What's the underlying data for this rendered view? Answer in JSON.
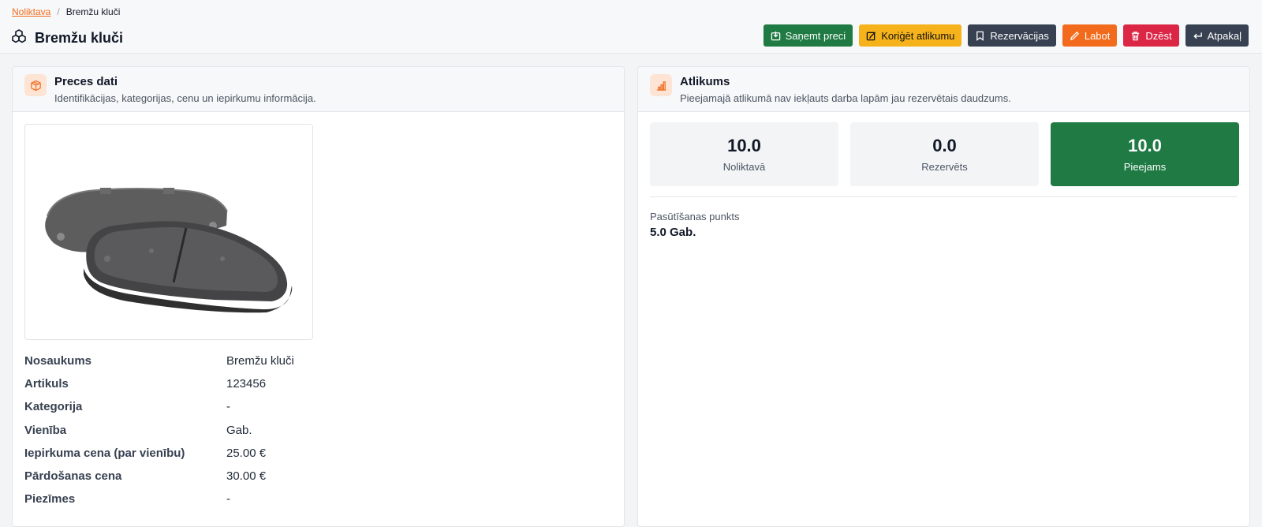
{
  "breadcrumb": {
    "parent": "Noliktava",
    "current": "Bremžu kluči"
  },
  "page": {
    "title": "Bremžu kluči",
    "title_icon": "cubes-icon"
  },
  "actions": {
    "receive": "Saņemt preci",
    "adjust": "Koriģēt atlikumu",
    "reservations": "Rezervācijas",
    "edit": "Labot",
    "delete": "Dzēst",
    "back": "Atpakaļ"
  },
  "colors": {
    "accent": "#f26b1d",
    "green": "#1f7a43",
    "yellow": "#f5b21a",
    "dark": "#374151",
    "red": "#dc2646"
  },
  "product_card": {
    "title": "Preces dati",
    "subtitle": "Identifikācijas, kategorijas, cenu un iepirkumu informācija.",
    "icon": "box-icon",
    "image": "brake-pads-image",
    "fields": [
      {
        "label": "Nosaukums",
        "value": "Bremžu kluči"
      },
      {
        "label": "Artikuls",
        "value": "123456"
      },
      {
        "label": "Kategorija",
        "value": "-"
      },
      {
        "label": "Vienība",
        "value": "Gab."
      },
      {
        "label": "Iepirkuma cena (par vienību)",
        "value": "25.00 €"
      },
      {
        "label": "Pārdošanas cena",
        "value": "30.00 €"
      },
      {
        "label": "Piezīmes",
        "value": "-"
      }
    ]
  },
  "stock_card": {
    "title": "Atlikums",
    "subtitle": "Pieejamajā atlikumā nav iekļauts darba lapām jau rezervētais daudzums.",
    "icon": "bar-chart-icon",
    "stats": [
      {
        "value": "10.0",
        "label": "Noliktavā"
      },
      {
        "value": "0.0",
        "label": "Rezervēts"
      },
      {
        "value": "10.0",
        "label": "Pieejams"
      }
    ],
    "reorder_label": "Pasūtīšanas punkts",
    "reorder_value": "5.0 Gab."
  }
}
